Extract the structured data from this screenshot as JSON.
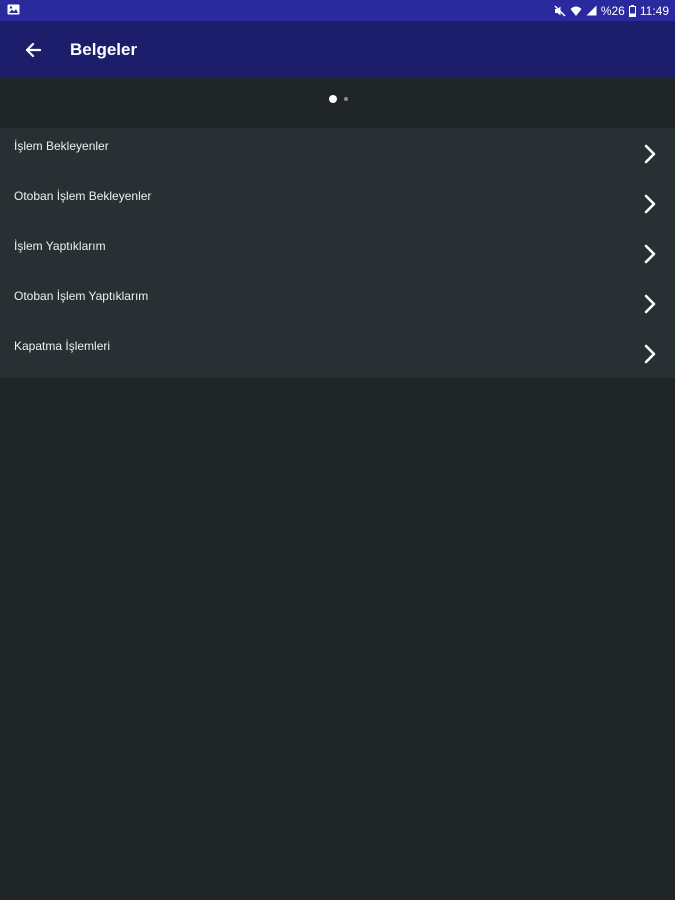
{
  "status_bar": {
    "battery_text": "%26",
    "time": "11:49",
    "icons": [
      "image-icon",
      "mute-icon",
      "wifi-icon",
      "signal-icon",
      "battery-icon"
    ]
  },
  "app_bar": {
    "title": "Belgeler",
    "back_icon": "arrow-left-icon",
    "background": "#1c1e6b"
  },
  "pager": {
    "pages": 2,
    "active_index": 0
  },
  "menu": {
    "items": [
      {
        "label": "İşlem Bekleyenler"
      },
      {
        "label": "Otoban İşlem Bekleyenler"
      },
      {
        "label": "İşlem Yaptıklarım"
      },
      {
        "label": "Otoban İşlem Yaptıklarım"
      },
      {
        "label": "Kapatma İşlemleri"
      }
    ],
    "chevron_icon": "chevron-right-icon"
  },
  "colors": {
    "status_bar": "#2a2a9e",
    "app_bar": "#1c1e6b",
    "background": "#202627",
    "list_background": "#293033"
  }
}
